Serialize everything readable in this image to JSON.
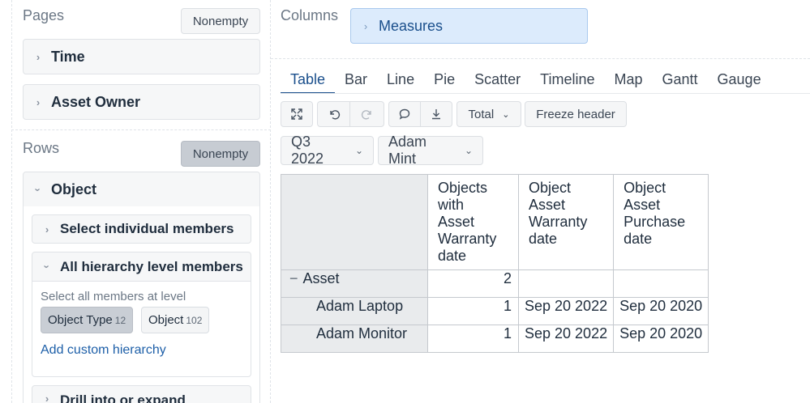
{
  "pages": {
    "title": "Pages",
    "nonempty_label": "Nonempty",
    "dimensions": [
      "Time",
      "Asset Owner"
    ]
  },
  "rows": {
    "title": "Rows",
    "nonempty_label": "Nonempty",
    "dimension": "Object",
    "select_individual": "Select individual members",
    "all_hierarchy": "All hierarchy level members",
    "select_all_level": "Select all members at level",
    "level_chips": [
      {
        "label": "Object Type",
        "count": "12"
      },
      {
        "label": "Object",
        "count": "102"
      }
    ],
    "add_custom": "Add custom hierarchy",
    "drill": "Drill into or expand"
  },
  "columns": {
    "title": "Columns",
    "measures": "Measures"
  },
  "tabs": [
    "Table",
    "Bar",
    "Line",
    "Pie",
    "Scatter",
    "Timeline",
    "Map",
    "Gantt",
    "Gauge"
  ],
  "active_tab": "Table",
  "toolbar": {
    "total_label": "Total",
    "freeze_label": "Freeze header"
  },
  "filters": [
    "Q3 2022",
    "Adam Mint"
  ],
  "table": {
    "headers": [
      [
        "Objects",
        "with",
        "Asset",
        "Warranty",
        "date"
      ],
      [
        "Object",
        "Asset",
        "Warranty",
        "date"
      ],
      [
        "Object",
        "Asset",
        "Purchase",
        "date"
      ]
    ],
    "rows": [
      {
        "label": "Asset",
        "collapse_glyph": "−",
        "values": [
          "2",
          "",
          ""
        ]
      },
      {
        "label": "Adam Laptop",
        "values": [
          "1",
          "Sep 20 2022",
          "Sep 20 2020"
        ]
      },
      {
        "label": "Adam Monitor",
        "values": [
          "1",
          "Sep 20 2022",
          "Sep 20 2020"
        ]
      }
    ]
  }
}
